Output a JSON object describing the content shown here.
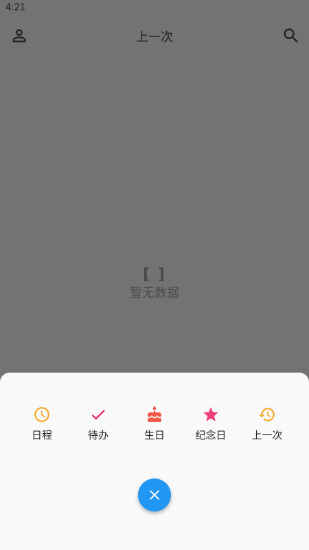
{
  "status_bar": {
    "time": "4:21"
  },
  "app_bar": {
    "title": "上一次",
    "user_icon": "person-outline-icon",
    "search_icon": "search-icon"
  },
  "empty_state": {
    "brackets": "[ ]",
    "message": "暂无数据"
  },
  "bottom_sheet": {
    "actions": [
      {
        "label": "日程",
        "icon": "clock-icon",
        "color": "#f5a623"
      },
      {
        "label": "待办",
        "icon": "check-icon",
        "color": "#e91e63"
      },
      {
        "label": "生日",
        "icon": "cake-icon",
        "color": "#f05545"
      },
      {
        "label": "纪念日",
        "icon": "star-icon",
        "color": "#ec407a"
      },
      {
        "label": "上一次",
        "icon": "history-icon",
        "color": "#f5a623"
      }
    ],
    "close_button": {
      "icon": "close-icon",
      "color": "#2196f3"
    }
  }
}
